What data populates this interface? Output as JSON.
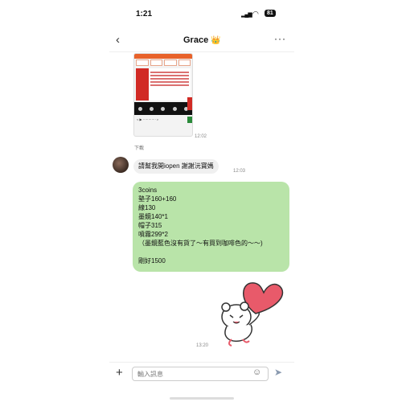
{
  "status_bar": {
    "time": "1:21",
    "battery": "81"
  },
  "header": {
    "title": "Grace",
    "title_emoji": "👑"
  },
  "messages": {
    "screenshot_time": "12:02",
    "separator": "下載",
    "incoming_text": "請幫我開iopen 謝謝沅寶媽",
    "incoming_time": "12:03",
    "outgoing_lines": [
      "3coins",
      "墊子160+160",
      "線130",
      "墨鏡140*1",
      "帽子315",
      "噴霧299*2",
      "（墨鏡藍色沒有貨了～有買到咖啡色的～～)",
      "",
      "剛好1500"
    ],
    "sticker_time": "13:20"
  },
  "input": {
    "placeholder": "輸入訊息"
  },
  "colors": {
    "outgoing_bubble": "#b9e4a9",
    "incoming_bubble": "#f0f0f0",
    "heart": "#e85a6a"
  }
}
